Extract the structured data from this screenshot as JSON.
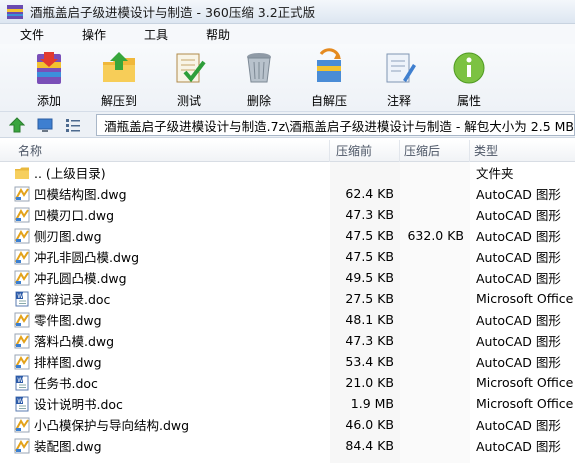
{
  "window": {
    "title": "酒瓶盖启子级进模设计与制造 - 360压缩 3.2正式版"
  },
  "menu": [
    "文件",
    "操作",
    "工具",
    "帮助"
  ],
  "toolbar": [
    {
      "label": "添加",
      "icon": "add-archive-icon"
    },
    {
      "label": "解压到",
      "icon": "extract-to-icon"
    },
    {
      "label": "测试",
      "icon": "test-icon"
    },
    {
      "label": "删除",
      "icon": "delete-icon"
    },
    {
      "label": "自解压",
      "icon": "self-extract-icon"
    },
    {
      "label": "注释",
      "icon": "comment-icon"
    },
    {
      "label": "属性",
      "icon": "properties-icon"
    }
  ],
  "address": {
    "path": "酒瓶盖启子级进模设计与制造.7z\\酒瓶盖启子级进模设计与制造 - 解包大小为 2.5 MB"
  },
  "columns": {
    "name": "名称",
    "packed": "压缩前",
    "compressed": "压缩后",
    "type": "类型"
  },
  "files": [
    {
      "name": ".. (上级目录)",
      "packed": "",
      "compressed": "",
      "type": "文件夹",
      "icon": "folder"
    },
    {
      "name": "凹模结构图.dwg",
      "packed": "62.4 KB",
      "compressed": "",
      "type": "AutoCAD 图形",
      "icon": "dwg"
    },
    {
      "name": "凹模刃口.dwg",
      "packed": "47.3 KB",
      "compressed": "",
      "type": "AutoCAD 图形",
      "icon": "dwg"
    },
    {
      "name": "侧刃图.dwg",
      "packed": "47.5 KB",
      "compressed": "632.0 KB",
      "type": "AutoCAD 图形",
      "icon": "dwg"
    },
    {
      "name": "冲孔非圆凸模.dwg",
      "packed": "47.5 KB",
      "compressed": "",
      "type": "AutoCAD 图形",
      "icon": "dwg"
    },
    {
      "name": "冲孔圆凸模.dwg",
      "packed": "49.5 KB",
      "compressed": "",
      "type": "AutoCAD 图形",
      "icon": "dwg"
    },
    {
      "name": "答辩记录.doc",
      "packed": "27.5 KB",
      "compressed": "",
      "type": "Microsoft Office ...",
      "icon": "doc"
    },
    {
      "name": "零件图.dwg",
      "packed": "48.1 KB",
      "compressed": "",
      "type": "AutoCAD 图形",
      "icon": "dwg"
    },
    {
      "name": "落料凸模.dwg",
      "packed": "47.3 KB",
      "compressed": "",
      "type": "AutoCAD 图形",
      "icon": "dwg"
    },
    {
      "name": "排样图.dwg",
      "packed": "53.4 KB",
      "compressed": "",
      "type": "AutoCAD 图形",
      "icon": "dwg"
    },
    {
      "name": "任务书.doc",
      "packed": "21.0 KB",
      "compressed": "",
      "type": "Microsoft Office ...",
      "icon": "doc"
    },
    {
      "name": "设计说明书.doc",
      "packed": "1.9 MB",
      "compressed": "",
      "type": "Microsoft Office ...",
      "icon": "doc"
    },
    {
      "name": "小凸模保护与导向结构.dwg",
      "packed": "46.0 KB",
      "compressed": "",
      "type": "AutoCAD 图形",
      "icon": "dwg"
    },
    {
      "name": "装配图.dwg",
      "packed": "84.4 KB",
      "compressed": "",
      "type": "AutoCAD 图形",
      "icon": "dwg"
    }
  ]
}
